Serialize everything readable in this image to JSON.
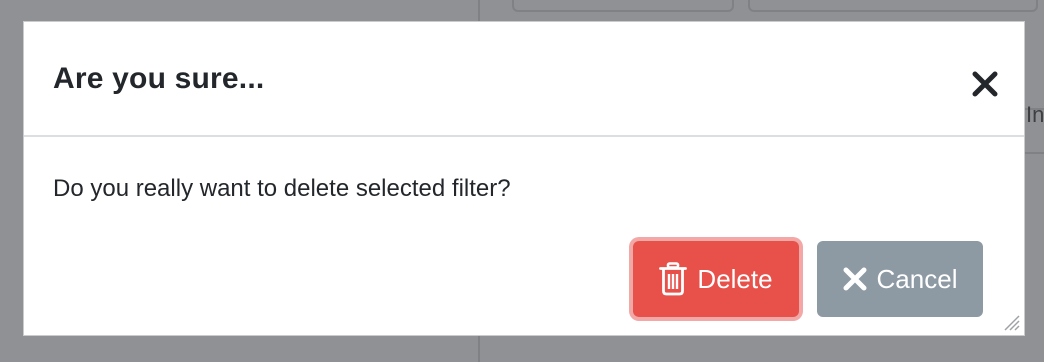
{
  "dialog": {
    "title": "Are you sure...",
    "message": "Do you really want to delete selected filter?",
    "close_icon": "close-icon",
    "buttons": {
      "delete_label": "Delete",
      "delete_icon": "trash-icon",
      "cancel_label": "Cancel",
      "cancel_icon": "close-icon"
    }
  },
  "background": {
    "partial_text": "In"
  },
  "colors": {
    "delete": "#e8504a",
    "delete_focus_ring": "#f2a8a6",
    "cancel": "#8d9aa4",
    "overlay": "#8f9194"
  }
}
